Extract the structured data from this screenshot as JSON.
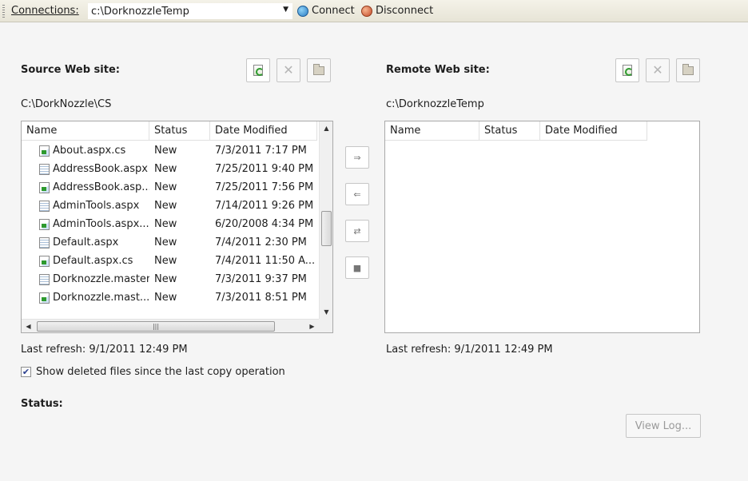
{
  "toolbar": {
    "connections_label": "Connections:",
    "connection_value": "c:\\DorknozzleTemp",
    "connect_label": "Connect",
    "disconnect_label": "Disconnect"
  },
  "source": {
    "title": "Source Web site:",
    "path": "C:\\DorkNozzle\\CS",
    "columns": [
      "Name",
      "Status",
      "Date Modified"
    ],
    "rows": [
      {
        "icon": "cs-file-icon",
        "name": "About.aspx.cs",
        "status": "New",
        "date": "7/3/2011 7:17 PM"
      },
      {
        "icon": "aspx-page-icon",
        "name": "AddressBook.aspx",
        "status": "New",
        "date": "7/25/2011 9:40 PM"
      },
      {
        "icon": "cs-file-icon",
        "name": "AddressBook.asp...",
        "status": "New",
        "date": "7/25/2011 7:56 PM"
      },
      {
        "icon": "aspx-page-icon",
        "name": "AdminTools.aspx",
        "status": "New",
        "date": "7/14/2011 9:26 PM"
      },
      {
        "icon": "cs-file-icon",
        "name": "AdminTools.aspx...",
        "status": "New",
        "date": "6/20/2008 4:34 PM"
      },
      {
        "icon": "aspx-page-icon",
        "name": "Default.aspx",
        "status": "New",
        "date": "7/4/2011 2:30 PM"
      },
      {
        "icon": "cs-file-icon",
        "name": "Default.aspx.cs",
        "status": "New",
        "date": "7/4/2011 11:50 A..."
      },
      {
        "icon": "aspx-page-icon",
        "name": "Dorknozzle.master",
        "status": "New",
        "date": "7/3/2011 9:37 PM"
      },
      {
        "icon": "cs-file-icon",
        "name": "Dorknozzle.mast...",
        "status": "New",
        "date": "7/3/2011 8:51 PM"
      }
    ],
    "last_refresh": "Last refresh: 9/1/2011 12:49 PM"
  },
  "remote": {
    "title": "Remote Web site:",
    "path": "c:\\DorknozzleTemp",
    "columns": [
      "Name",
      "Status",
      "Date Modified"
    ],
    "last_refresh": "Last refresh: 9/1/2011 12:49 PM"
  },
  "transfer_buttons": [
    "copy-right-icon",
    "copy-left-icon",
    "sync-icon",
    "stop-icon"
  ],
  "show_deleted": {
    "checked": true,
    "label": "Show deleted files since the last copy operation"
  },
  "status_label": "Status:",
  "view_log_label": "View Log...",
  "colors": {
    "toolbar_bg": "#e7e4d6",
    "page_bg": "#f5f5f5",
    "border": "#a9a9a9"
  }
}
